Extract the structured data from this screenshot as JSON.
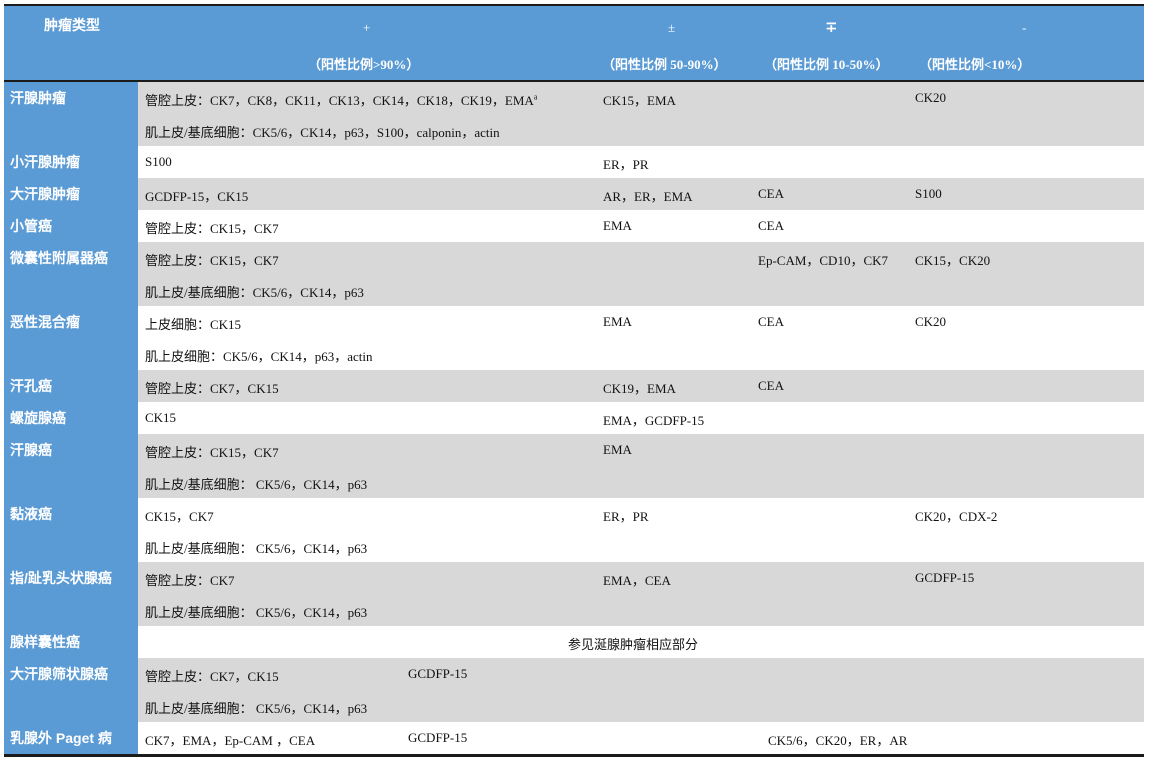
{
  "header": {
    "col_type": "肿瘤类型",
    "sym_pos": "+",
    "sym_pm": "±",
    "sym_mp": "∓",
    "sym_neg": "-",
    "sub_pos": "（阳性比例>90%）",
    "sub_pm": "（阳性比例 50-90%）",
    "sub_mp": "（阳性比例 10-50%）",
    "sub_neg": "（阳性比例<10%）"
  },
  "rows": [
    {
      "name": "汗腺肿瘤",
      "shade": "gray",
      "lines": [
        {
          "pos": "管腔上皮：CK7，CK8，CK11，CK13，CK14，CK18，CK19，EMA",
          "pos_sup": "a",
          "pm": "CK15，EMA",
          "mp": "",
          "neg": "CK20"
        },
        {
          "pos": "肌上皮/基底细胞：CK5/6，CK14，p63，S100，calponin，actin",
          "pm": "",
          "mp": "",
          "neg": ""
        }
      ]
    },
    {
      "name": "小汗腺肿瘤",
      "shade": "white",
      "lines": [
        {
          "pos": "S100",
          "pm": "ER，PR",
          "mp": "",
          "neg": ""
        }
      ]
    },
    {
      "name": "大汗腺肿瘤",
      "shade": "gray",
      "lines": [
        {
          "pos": "GCDFP-15，CK15",
          "pm": "AR，ER，EMA",
          "mp": "CEA",
          "neg": "S100"
        }
      ]
    },
    {
      "name": "小管癌",
      "shade": "white",
      "lines": [
        {
          "pos": "管腔上皮：CK15，CK7",
          "pm": "EMA",
          "mp": "CEA",
          "neg": ""
        }
      ]
    },
    {
      "name": "微囊性附属器癌",
      "shade": "gray",
      "lines": [
        {
          "pos": "管腔上皮：CK15，CK7",
          "pm": "",
          "mp": "Ep-CAM，CD10，CK7",
          "neg": "CK15，CK20"
        },
        {
          "pos": "肌上皮/基底细胞：CK5/6，CK14，p63",
          "pm": "",
          "mp": "",
          "neg": ""
        }
      ]
    },
    {
      "name": "恶性混合瘤",
      "shade": "white",
      "lines": [
        {
          "pos": "上皮细胞：CK15",
          "pm": "EMA",
          "mp": "CEA",
          "neg": "CK20"
        },
        {
          "pos": "肌上皮细胞：CK5/6，CK14，p63，actin",
          "pm": "",
          "mp": "",
          "neg": ""
        }
      ]
    },
    {
      "name": "汗孔癌",
      "shade": "gray",
      "lines": [
        {
          "pos": "管腔上皮：CK7，CK15",
          "pm": "CK19，EMA",
          "mp": "CEA",
          "neg": ""
        }
      ]
    },
    {
      "name": "螺旋腺癌",
      "shade": "white",
      "lines": [
        {
          "pos": "CK15",
          "pm": "EMA，GCDFP-15",
          "mp": "",
          "neg": ""
        }
      ]
    },
    {
      "name": "汗腺癌",
      "shade": "gray",
      "lines": [
        {
          "pos": "管腔上皮：CK15，CK7",
          "pm": "EMA",
          "mp": "",
          "neg": ""
        },
        {
          "pos": "肌上皮/基底细胞：  CK5/6，CK14，p63",
          "pm": "",
          "mp": "",
          "neg": ""
        }
      ]
    },
    {
      "name": "黏液癌",
      "shade": "white",
      "lines": [
        {
          "pos": "CK15，CK7",
          "pm": "ER，PR",
          "mp": "",
          "neg": "CK20，CDX-2"
        },
        {
          "pos": "肌上皮/基底细胞：  CK5/6，CK14，p63",
          "pm": "",
          "mp": "",
          "neg": ""
        }
      ]
    },
    {
      "name": "指/趾乳头状腺癌",
      "shade": "gray",
      "lines": [
        {
          "pos": "管腔上皮：CK7",
          "pm": "EMA，CEA",
          "mp": "",
          "neg": "GCDFP-15"
        },
        {
          "pos": "肌上皮/基底细胞：  CK5/6，CK14，p63",
          "pm": "",
          "mp": "",
          "neg": ""
        }
      ]
    },
    {
      "name": "腺样囊性癌",
      "shade": "white",
      "span": "参见涎腺肿瘤相应部分",
      "lines": []
    },
    {
      "name": "大汗腺筛状腺癌",
      "shade": "gray",
      "lines": [
        {
          "pos": "管腔上皮：CK7，CK15",
          "pos2": "GCDFP-15",
          "pm": "",
          "mp": "",
          "neg": ""
        },
        {
          "pos": "肌上皮/基底细胞：  CK5/6，CK14，p63",
          "pm": "",
          "mp": "",
          "neg": ""
        }
      ]
    },
    {
      "name": "乳腺外 Paget 病",
      "shade": "white",
      "lines": [
        {
          "pos": "CK7，EMA，Ep-CAM ，CEA",
          "pos2": "GCDFP-15",
          "pm": "",
          "mp2": "CK5/6，CK20，ER，AR",
          "neg": ""
        }
      ]
    }
  ]
}
